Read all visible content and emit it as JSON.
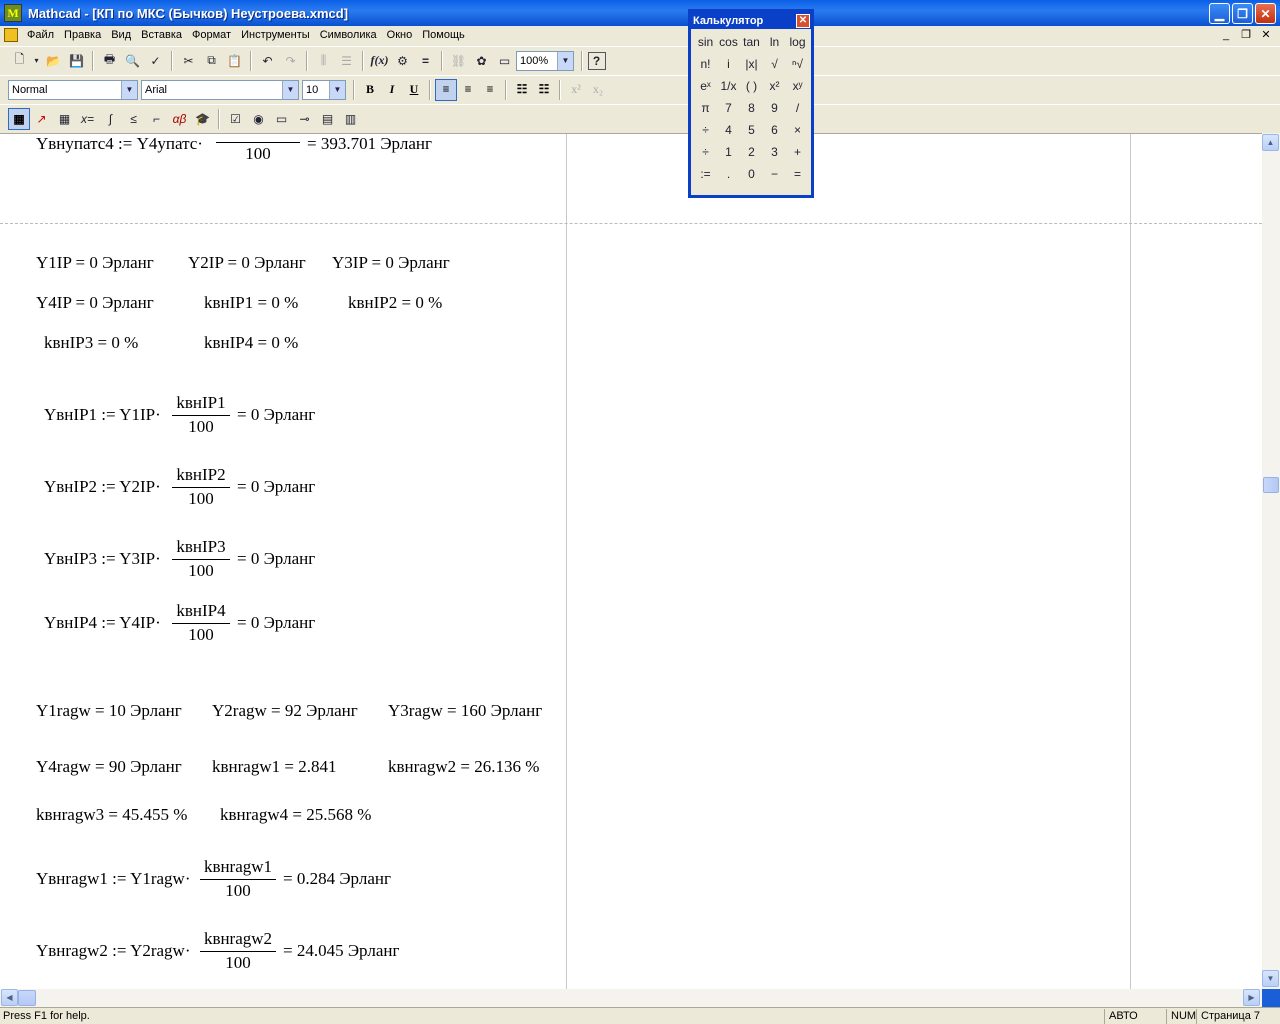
{
  "window": {
    "title": "Mathcad - [КП по МКС (Бычков) Неустроева.xmcd]",
    "app_icon_letter": "M"
  },
  "menu": [
    "Файл",
    "Правка",
    "Вид",
    "Вставка",
    "Формат",
    "Инструменты",
    "Символика",
    "Окно",
    "Помощь"
  ],
  "standard_toolbar": {
    "zoom": "100%"
  },
  "format_toolbar": {
    "style": "Normal",
    "font": "Arial",
    "size": "10"
  },
  "worksheet": {
    "lines": [
      "Y4IP = 0  Эрланг",
      "kвнIP1 = 0  %",
      "kвнIP2 = 0  %",
      "kвнIP3 = 0  %",
      "kвнIP4 = 0  %"
    ],
    "top_line": {
      "lhs": "Yвнупатс4 := Y4упатс·",
      "den": "100",
      "rhs": "= 393.701    Эрланг"
    },
    "row1": {
      "a": "Y1IP = 0 Эрланг",
      "b": "Y2IP = 0 Эрланг",
      "c": "Y3IP = 0 Эрланг"
    },
    "fractions": [
      {
        "lhs": "YвнIP1 := Y1IP·",
        "num": "kвнIP1",
        "den": "100",
        "rhs": "= 0 Эрланг"
      },
      {
        "lhs": "YвнIP2 := Y2IP·",
        "num": "kвнIP2",
        "den": "100",
        "rhs": "= 0 Эрланг"
      },
      {
        "lhs": "YвнIP3 := Y3IP·",
        "num": "kвнIP3",
        "den": "100",
        "rhs": "= 0 Эрланг"
      },
      {
        "lhs": "YвнIP4 := Y4IP·",
        "num": "kвнIP4",
        "den": "100",
        "rhs": "= 0 Эрланг"
      },
      {
        "lhs": "Yвнragw1 := Y1ragw·",
        "num": "kвнragw1",
        "den": "100",
        "rhs": "= 0.284   Эрланг"
      },
      {
        "lhs": "Yвнragw2 := Y2ragw·",
        "num": "kвнragw2",
        "den": "100",
        "rhs": "= 24.045  Эрланг"
      }
    ],
    "ragw1": {
      "a": "Y1ragw = 10  Эрланг",
      "b": "Y2ragw = 92  Эрланг",
      "c": "Y3ragw = 160  Эрланг"
    },
    "ragw2": {
      "a": "Y4ragw = 90  Эрланг",
      "b": "kвнragw1 = 2.841",
      "c": "kвнragw2 = 26.136  %"
    },
    "ragw3": {
      "a": "kвнragw3 = 45.455  %",
      "b": "kвнragw4 = 25.568  %"
    }
  },
  "calculator": {
    "title": "Калькулятор",
    "keys": [
      "sin",
      "cos",
      "tan",
      "ln",
      "log",
      "n!",
      "i",
      "|x|",
      "√",
      "ⁿ√",
      "eˣ",
      "1/x",
      "( )",
      "x²",
      "xʸ",
      "π",
      "7",
      "8",
      "9",
      "/",
      "÷",
      "4",
      "5",
      "6",
      "×",
      "÷",
      "1",
      "2",
      "3",
      "+",
      ":=",
      ".",
      "0",
      "−",
      "="
    ]
  },
  "status": {
    "help": "Press F1 for help.",
    "auto": "АВТО",
    "num": "NUM",
    "page": "Страница 7"
  }
}
